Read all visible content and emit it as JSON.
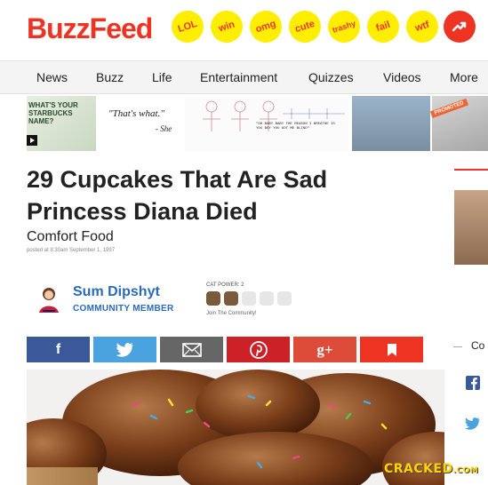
{
  "header": {
    "logo": "BuzzFeed",
    "badges": [
      "LOL",
      "win",
      "omg",
      "cute",
      "trashy",
      "fail",
      "wtf"
    ],
    "trending_icon": "trending-arrow-icon",
    "accent": "#ee3322",
    "badge_color": "#ffee00"
  },
  "nav": {
    "items": [
      "News",
      "Buzz",
      "Life",
      "Entertainment",
      "Quizzes",
      "Videos",
      "More"
    ]
  },
  "ads": {
    "ad1": {
      "left_text": "WHAT'S YOUR STARBUCKS NAME?",
      "quote": "\"That's what.\"",
      "attribution": "- She"
    },
    "ad2": {
      "caption": "\"OH BABY BABY THE REASON I BREATHE IS YOU BOY YOU GOT ME BLIND\""
    },
    "promoted": "PROMOTED"
  },
  "article": {
    "title": "29 Cupcakes That Are Sad Princess Diana Died",
    "category": "Comfort Food",
    "posted": "posted at 8:30am September 1, 1997"
  },
  "author": {
    "name": "Sum Dipshyt",
    "role": "COMMUNITY MEMBER",
    "cat_power_label": "CAT POWER: 2",
    "cat_power": 2,
    "cat_power_max": 5,
    "join": "Join The Community!"
  },
  "share": {
    "buttons": [
      {
        "label": "f",
        "icon": "facebook-icon"
      },
      {
        "label": "",
        "icon": "twitter-icon"
      },
      {
        "label": "",
        "icon": "mail-icon"
      },
      {
        "label": "",
        "icon": "pinterest-icon"
      },
      {
        "label": "g+",
        "icon": "google-plus-icon"
      },
      {
        "label": "",
        "icon": "bookmark-icon"
      }
    ],
    "right_partial": "Co"
  },
  "watermark": {
    "main": "CRACKED",
    "suffix": ".COM"
  }
}
